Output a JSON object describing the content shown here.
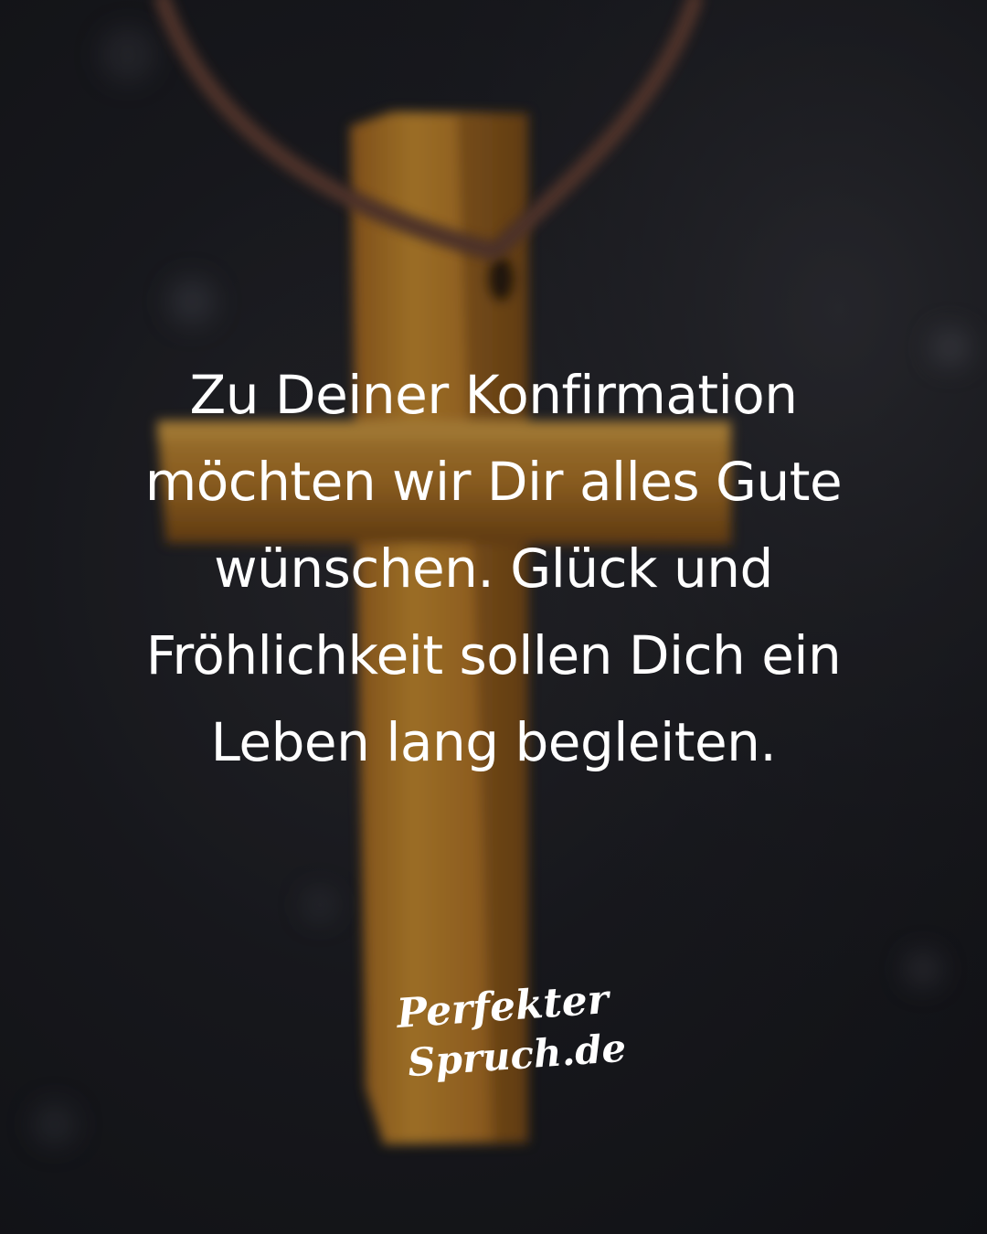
{
  "quote": {
    "lines": [
      "Zu Deiner Konfirmation",
      "möchten wir Dir alles Gute",
      "wünschen. Glück und",
      "Fröhlichkeit sollen Dich ein",
      "Leben lang begleiten."
    ]
  },
  "logo": {
    "line1": "Perfekter",
    "line2": "Spruch.de"
  },
  "colors": {
    "background": "#1c1d22",
    "cross_wood": "#c98a2e",
    "cord": "#5a3a2e",
    "text": "#ffffff"
  }
}
